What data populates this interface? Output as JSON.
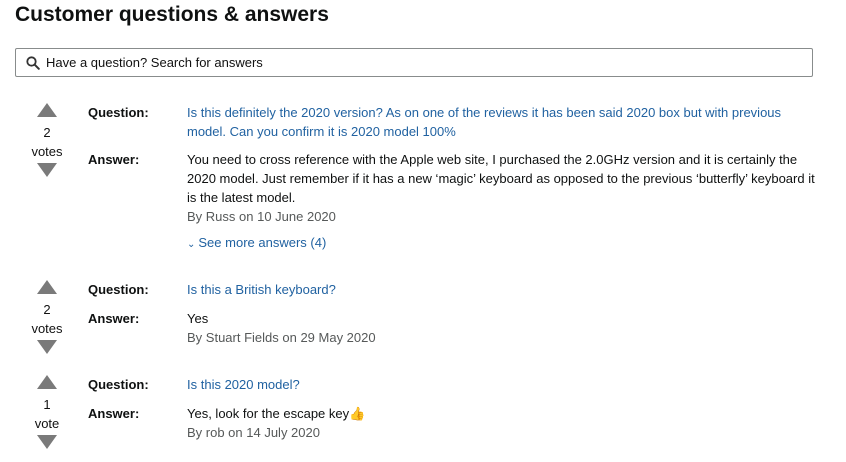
{
  "page": {
    "title": "Customer questions & answers"
  },
  "search": {
    "placeholder": "Have a question? Search for answers"
  },
  "qa_items": [
    {
      "votes": "2",
      "votes_label": "votes",
      "question_label": "Question:",
      "question": "Is this definitely the 2020 version? As on one of the reviews it has been said 2020 box but with previous model. Can you confirm it is 2020 model 100%",
      "answer_label": "Answer:",
      "answer": "You need to cross reference with the Apple web site, I purchased the 2.0GHz version and it is certainly the 2020 model. Just remember if it has a new ‘magic’ keyboard as opposed to the previous ‘butterfly’ keyboard it is the latest model.",
      "byline": "By Russ on 10 June 2020",
      "see_more": "See more answers (4)"
    },
    {
      "votes": "2",
      "votes_label": "votes",
      "question_label": "Question:",
      "question": "Is this a British keyboard?",
      "answer_label": "Answer:",
      "answer": "Yes",
      "byline": "By Stuart Fields on 29 May 2020"
    },
    {
      "votes": "1",
      "votes_label": "vote",
      "question_label": "Question:",
      "question": "Is this 2020 model?",
      "answer_label": "Answer:",
      "answer": "Yes, look for the escape key👍",
      "byline": "By rob on 14 July 2020"
    }
  ],
  "icons": {
    "search": "search-icon",
    "upvote": "triangle-up-icon",
    "downvote": "triangle-down-icon",
    "chevron": "chevron-down-icon"
  },
  "colors": {
    "link": "#2162a1",
    "text": "#0f1111",
    "byline": "#565959",
    "arrow": "#7a7a7a",
    "search_border": "#888c8c"
  }
}
